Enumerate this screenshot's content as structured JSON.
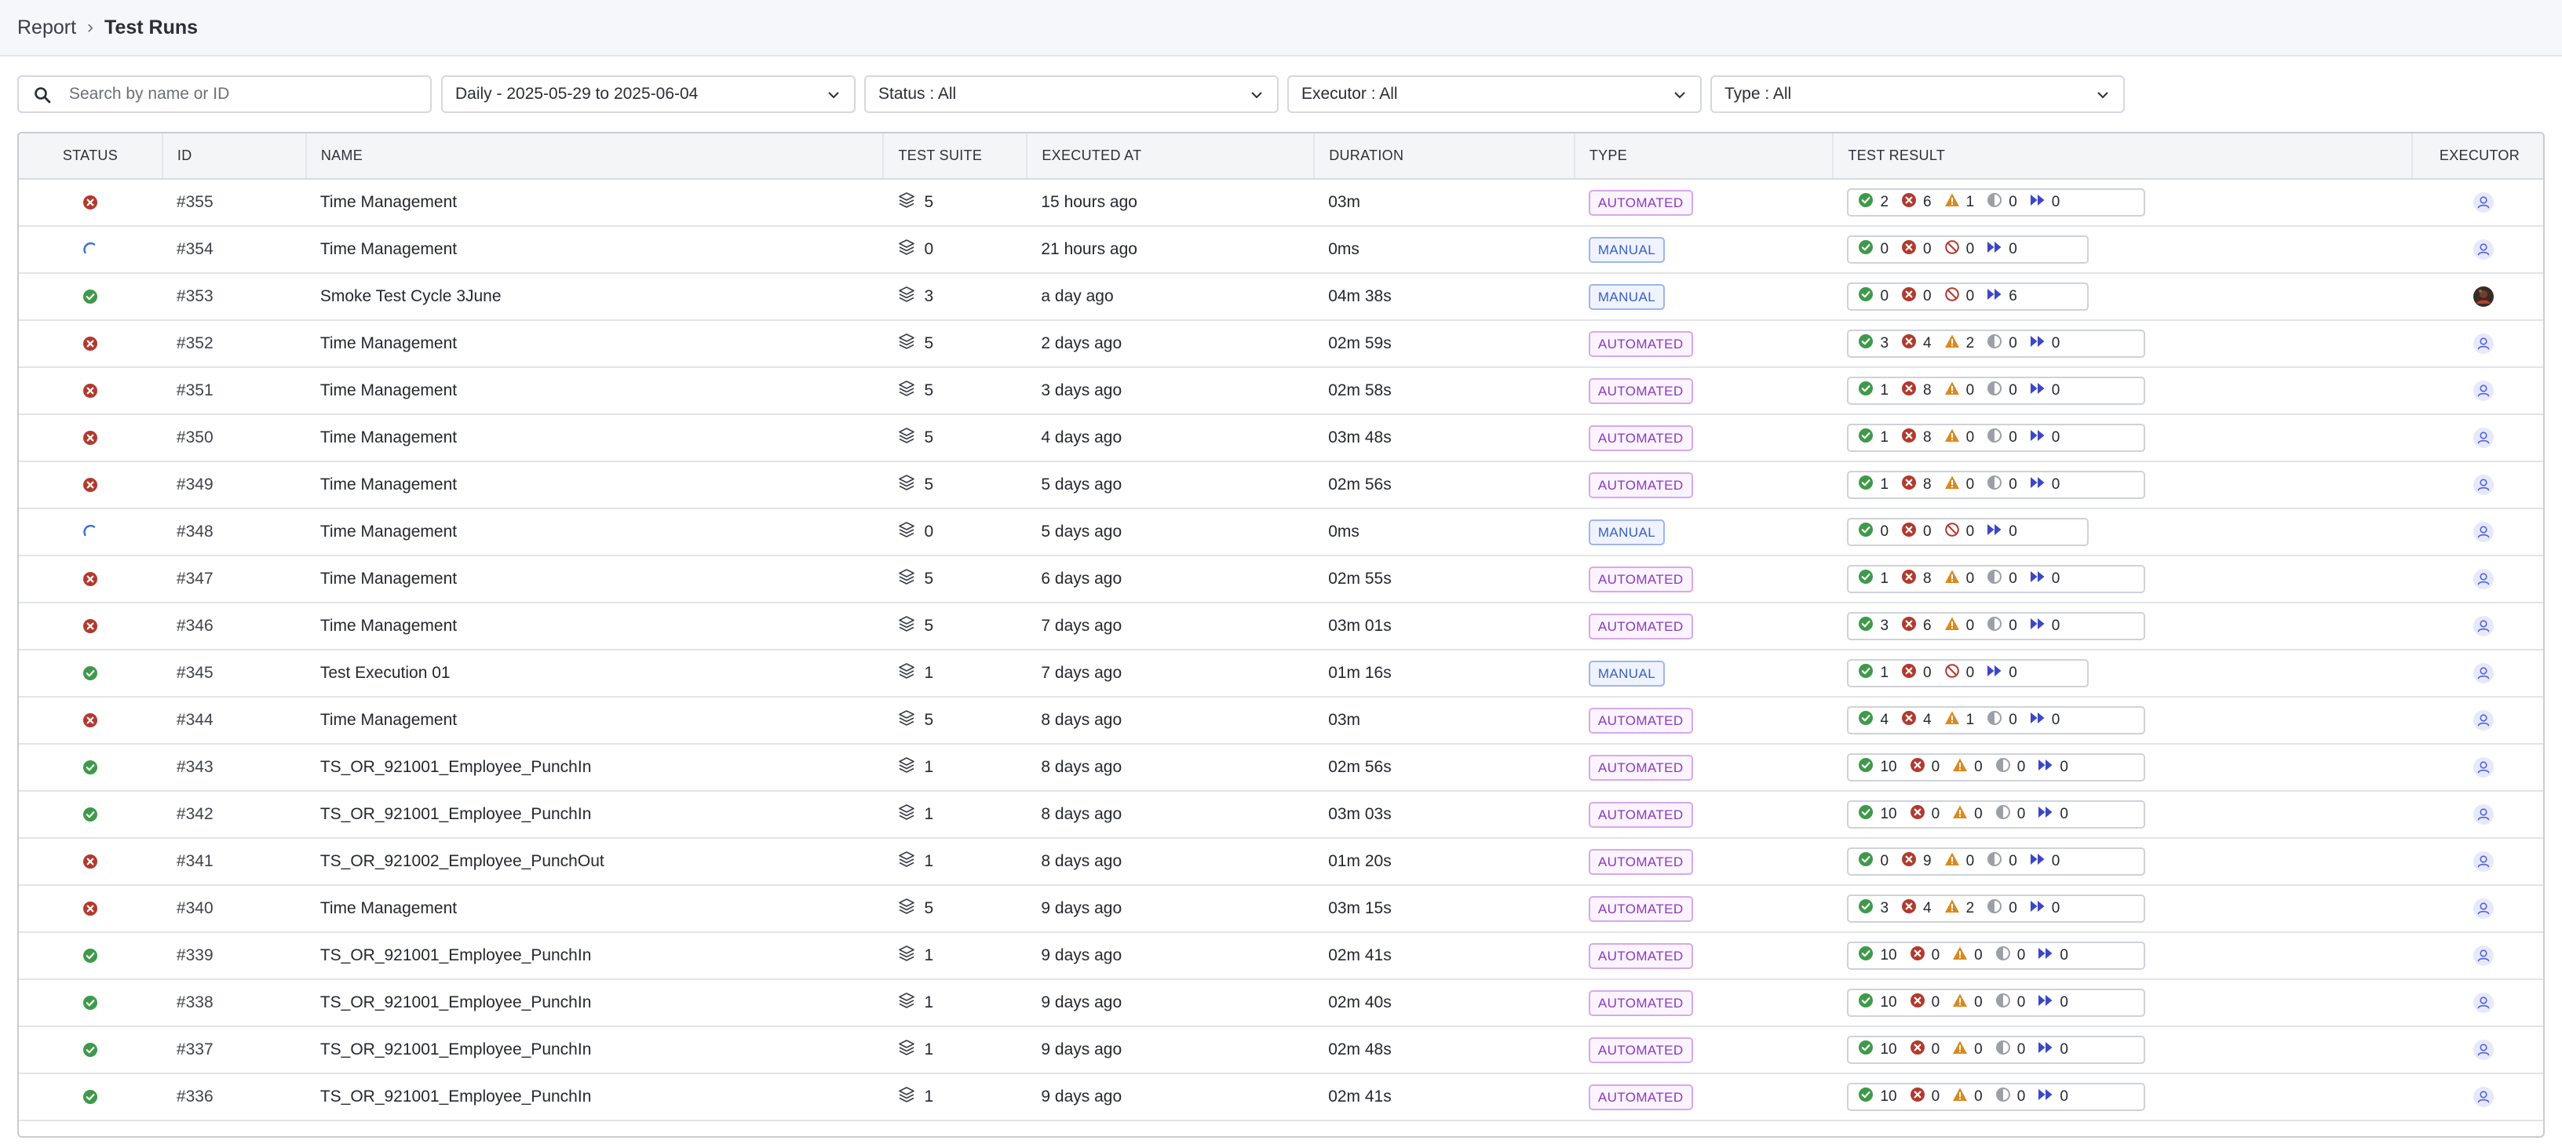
{
  "breadcrumb": {
    "root": "Report",
    "separator": "›",
    "current": "Test Runs"
  },
  "filters": {
    "search_placeholder": "Search by name or ID",
    "date_range": "Daily - 2025-05-29 to 2025-06-04",
    "status": "Status : All",
    "executor": "Executor : All",
    "type": "Type : All"
  },
  "columns": [
    "STATUS",
    "ID",
    "NAME",
    "TEST SUITE",
    "EXECUTED AT",
    "DURATION",
    "TYPE",
    "TEST RESULT",
    "EXECUTOR"
  ],
  "colors": {
    "passed": "#3e9a4a",
    "failed": "#b13a2e",
    "warning": "#d98a1e",
    "incomplete": "#9ba0a8",
    "skipped": "#3b47c9",
    "running": "#3b6fd6",
    "automated": "#8a3ab8",
    "manual": "#3b5fc0"
  },
  "rows": [
    {
      "status": "failed",
      "id": "#355",
      "name": "Time Management",
      "suite": "5",
      "executed": "15 hours ago",
      "duration": "03m",
      "type": "AUTOMATED",
      "kind": "auto",
      "passed": "2",
      "failed": "6",
      "third": "1",
      "incomplete": "0",
      "skipped": "0",
      "executor": "default"
    },
    {
      "status": "running",
      "id": "#354",
      "name": "Time Management",
      "suite": "0",
      "executed": "21 hours ago",
      "duration": "0ms",
      "type": "MANUAL",
      "kind": "manual",
      "passed": "0",
      "failed": "0",
      "third": "0",
      "skipped": "0",
      "executor": "default"
    },
    {
      "status": "passed",
      "id": "#353",
      "name": "Smoke Test Cycle 3June",
      "suite": "3",
      "executed": "a day ago",
      "duration": "04m 38s",
      "type": "MANUAL",
      "kind": "manual",
      "passed": "0",
      "failed": "0",
      "third": "0",
      "skipped": "6",
      "executor": "photo"
    },
    {
      "status": "failed",
      "id": "#352",
      "name": "Time Management",
      "suite": "5",
      "executed": "2 days ago",
      "duration": "02m 59s",
      "type": "AUTOMATED",
      "kind": "auto",
      "passed": "3",
      "failed": "4",
      "third": "2",
      "incomplete": "0",
      "skipped": "0",
      "executor": "default"
    },
    {
      "status": "failed",
      "id": "#351",
      "name": "Time Management",
      "suite": "5",
      "executed": "3 days ago",
      "duration": "02m 58s",
      "type": "AUTOMATED",
      "kind": "auto",
      "passed": "1",
      "failed": "8",
      "third": "0",
      "incomplete": "0",
      "skipped": "0",
      "executor": "default"
    },
    {
      "status": "failed",
      "id": "#350",
      "name": "Time Management",
      "suite": "5",
      "executed": "4 days ago",
      "duration": "03m 48s",
      "type": "AUTOMATED",
      "kind": "auto",
      "passed": "1",
      "failed": "8",
      "third": "0",
      "incomplete": "0",
      "skipped": "0",
      "executor": "default"
    },
    {
      "status": "failed",
      "id": "#349",
      "name": "Time Management",
      "suite": "5",
      "executed": "5 days ago",
      "duration": "02m 56s",
      "type": "AUTOMATED",
      "kind": "auto",
      "passed": "1",
      "failed": "8",
      "third": "0",
      "incomplete": "0",
      "skipped": "0",
      "executor": "default"
    },
    {
      "status": "running",
      "id": "#348",
      "name": "Time Management",
      "suite": "0",
      "executed": "5 days ago",
      "duration": "0ms",
      "type": "MANUAL",
      "kind": "manual",
      "passed": "0",
      "failed": "0",
      "third": "0",
      "skipped": "0",
      "executor": "default"
    },
    {
      "status": "failed",
      "id": "#347",
      "name": "Time Management",
      "suite": "5",
      "executed": "6 days ago",
      "duration": "02m 55s",
      "type": "AUTOMATED",
      "kind": "auto",
      "passed": "1",
      "failed": "8",
      "third": "0",
      "incomplete": "0",
      "skipped": "0",
      "executor": "default"
    },
    {
      "status": "failed",
      "id": "#346",
      "name": "Time Management",
      "suite": "5",
      "executed": "7 days ago",
      "duration": "03m 01s",
      "type": "AUTOMATED",
      "kind": "auto",
      "passed": "3",
      "failed": "6",
      "third": "0",
      "incomplete": "0",
      "skipped": "0",
      "executor": "default"
    },
    {
      "status": "passed",
      "id": "#345",
      "name": "Test Execution 01",
      "suite": "1",
      "executed": "7 days ago",
      "duration": "01m 16s",
      "type": "MANUAL",
      "kind": "manual",
      "passed": "1",
      "failed": "0",
      "third": "0",
      "skipped": "0",
      "executor": "default"
    },
    {
      "status": "failed",
      "id": "#344",
      "name": "Time Management",
      "suite": "5",
      "executed": "8 days ago",
      "duration": "03m",
      "type": "AUTOMATED",
      "kind": "auto",
      "passed": "4",
      "failed": "4",
      "third": "1",
      "incomplete": "0",
      "skipped": "0",
      "executor": "default"
    },
    {
      "status": "passed",
      "id": "#343",
      "name": "TS_OR_921001_Employee_PunchIn",
      "suite": "1",
      "executed": "8 days ago",
      "duration": "02m 56s",
      "type": "AUTOMATED",
      "kind": "auto",
      "passed": "10",
      "failed": "0",
      "third": "0",
      "incomplete": "0",
      "skipped": "0",
      "executor": "default"
    },
    {
      "status": "passed",
      "id": "#342",
      "name": "TS_OR_921001_Employee_PunchIn",
      "suite": "1",
      "executed": "8 days ago",
      "duration": "03m 03s",
      "type": "AUTOMATED",
      "kind": "auto",
      "passed": "10",
      "failed": "0",
      "third": "0",
      "incomplete": "0",
      "skipped": "0",
      "executor": "default"
    },
    {
      "status": "failed",
      "id": "#341",
      "name": "TS_OR_921002_Employee_PunchOut",
      "suite": "1",
      "executed": "8 days ago",
      "duration": "01m 20s",
      "type": "AUTOMATED",
      "kind": "auto",
      "passed": "0",
      "failed": "9",
      "third": "0",
      "incomplete": "0",
      "skipped": "0",
      "executor": "default"
    },
    {
      "status": "failed",
      "id": "#340",
      "name": "Time Management",
      "suite": "5",
      "executed": "9 days ago",
      "duration": "03m 15s",
      "type": "AUTOMATED",
      "kind": "auto",
      "passed": "3",
      "failed": "4",
      "third": "2",
      "incomplete": "0",
      "skipped": "0",
      "executor": "default"
    },
    {
      "status": "passed",
      "id": "#339",
      "name": "TS_OR_921001_Employee_PunchIn",
      "suite": "1",
      "executed": "9 days ago",
      "duration": "02m 41s",
      "type": "AUTOMATED",
      "kind": "auto",
      "passed": "10",
      "failed": "0",
      "third": "0",
      "incomplete": "0",
      "skipped": "0",
      "executor": "default"
    },
    {
      "status": "passed",
      "id": "#338",
      "name": "TS_OR_921001_Employee_PunchIn",
      "suite": "1",
      "executed": "9 days ago",
      "duration": "02m 40s",
      "type": "AUTOMATED",
      "kind": "auto",
      "passed": "10",
      "failed": "0",
      "third": "0",
      "incomplete": "0",
      "skipped": "0",
      "executor": "default"
    },
    {
      "status": "passed",
      "id": "#337",
      "name": "TS_OR_921001_Employee_PunchIn",
      "suite": "1",
      "executed": "9 days ago",
      "duration": "02m 48s",
      "type": "AUTOMATED",
      "kind": "auto",
      "passed": "10",
      "failed": "0",
      "third": "0",
      "incomplete": "0",
      "skipped": "0",
      "executor": "default"
    },
    {
      "status": "passed",
      "id": "#336",
      "name": "TS_OR_921001_Employee_PunchIn",
      "suite": "1",
      "executed": "9 days ago",
      "duration": "02m 41s",
      "type": "AUTOMATED",
      "kind": "auto",
      "passed": "10",
      "failed": "0",
      "third": "0",
      "incomplete": "0",
      "skipped": "0",
      "executor": "default"
    }
  ]
}
